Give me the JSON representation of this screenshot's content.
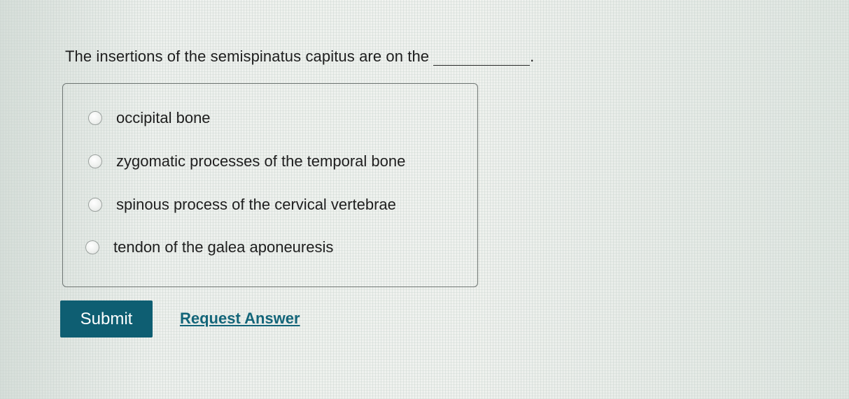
{
  "question": {
    "text": "The insertions of the semispinatus capitus are on the",
    "trailing": "."
  },
  "options": [
    {
      "label": "occipital bone",
      "selected": false
    },
    {
      "label": "zygomatic processes of the temporal bone",
      "selected": false
    },
    {
      "label": "spinous process of the cervical vertebrae",
      "selected": false
    },
    {
      "label": "tendon of the galea aponeuresis",
      "selected": false
    }
  ],
  "actions": {
    "submit_label": "Submit",
    "request_label": "Request Answer"
  },
  "colors": {
    "submit_bg": "#0e5e72",
    "link": "#136579"
  }
}
